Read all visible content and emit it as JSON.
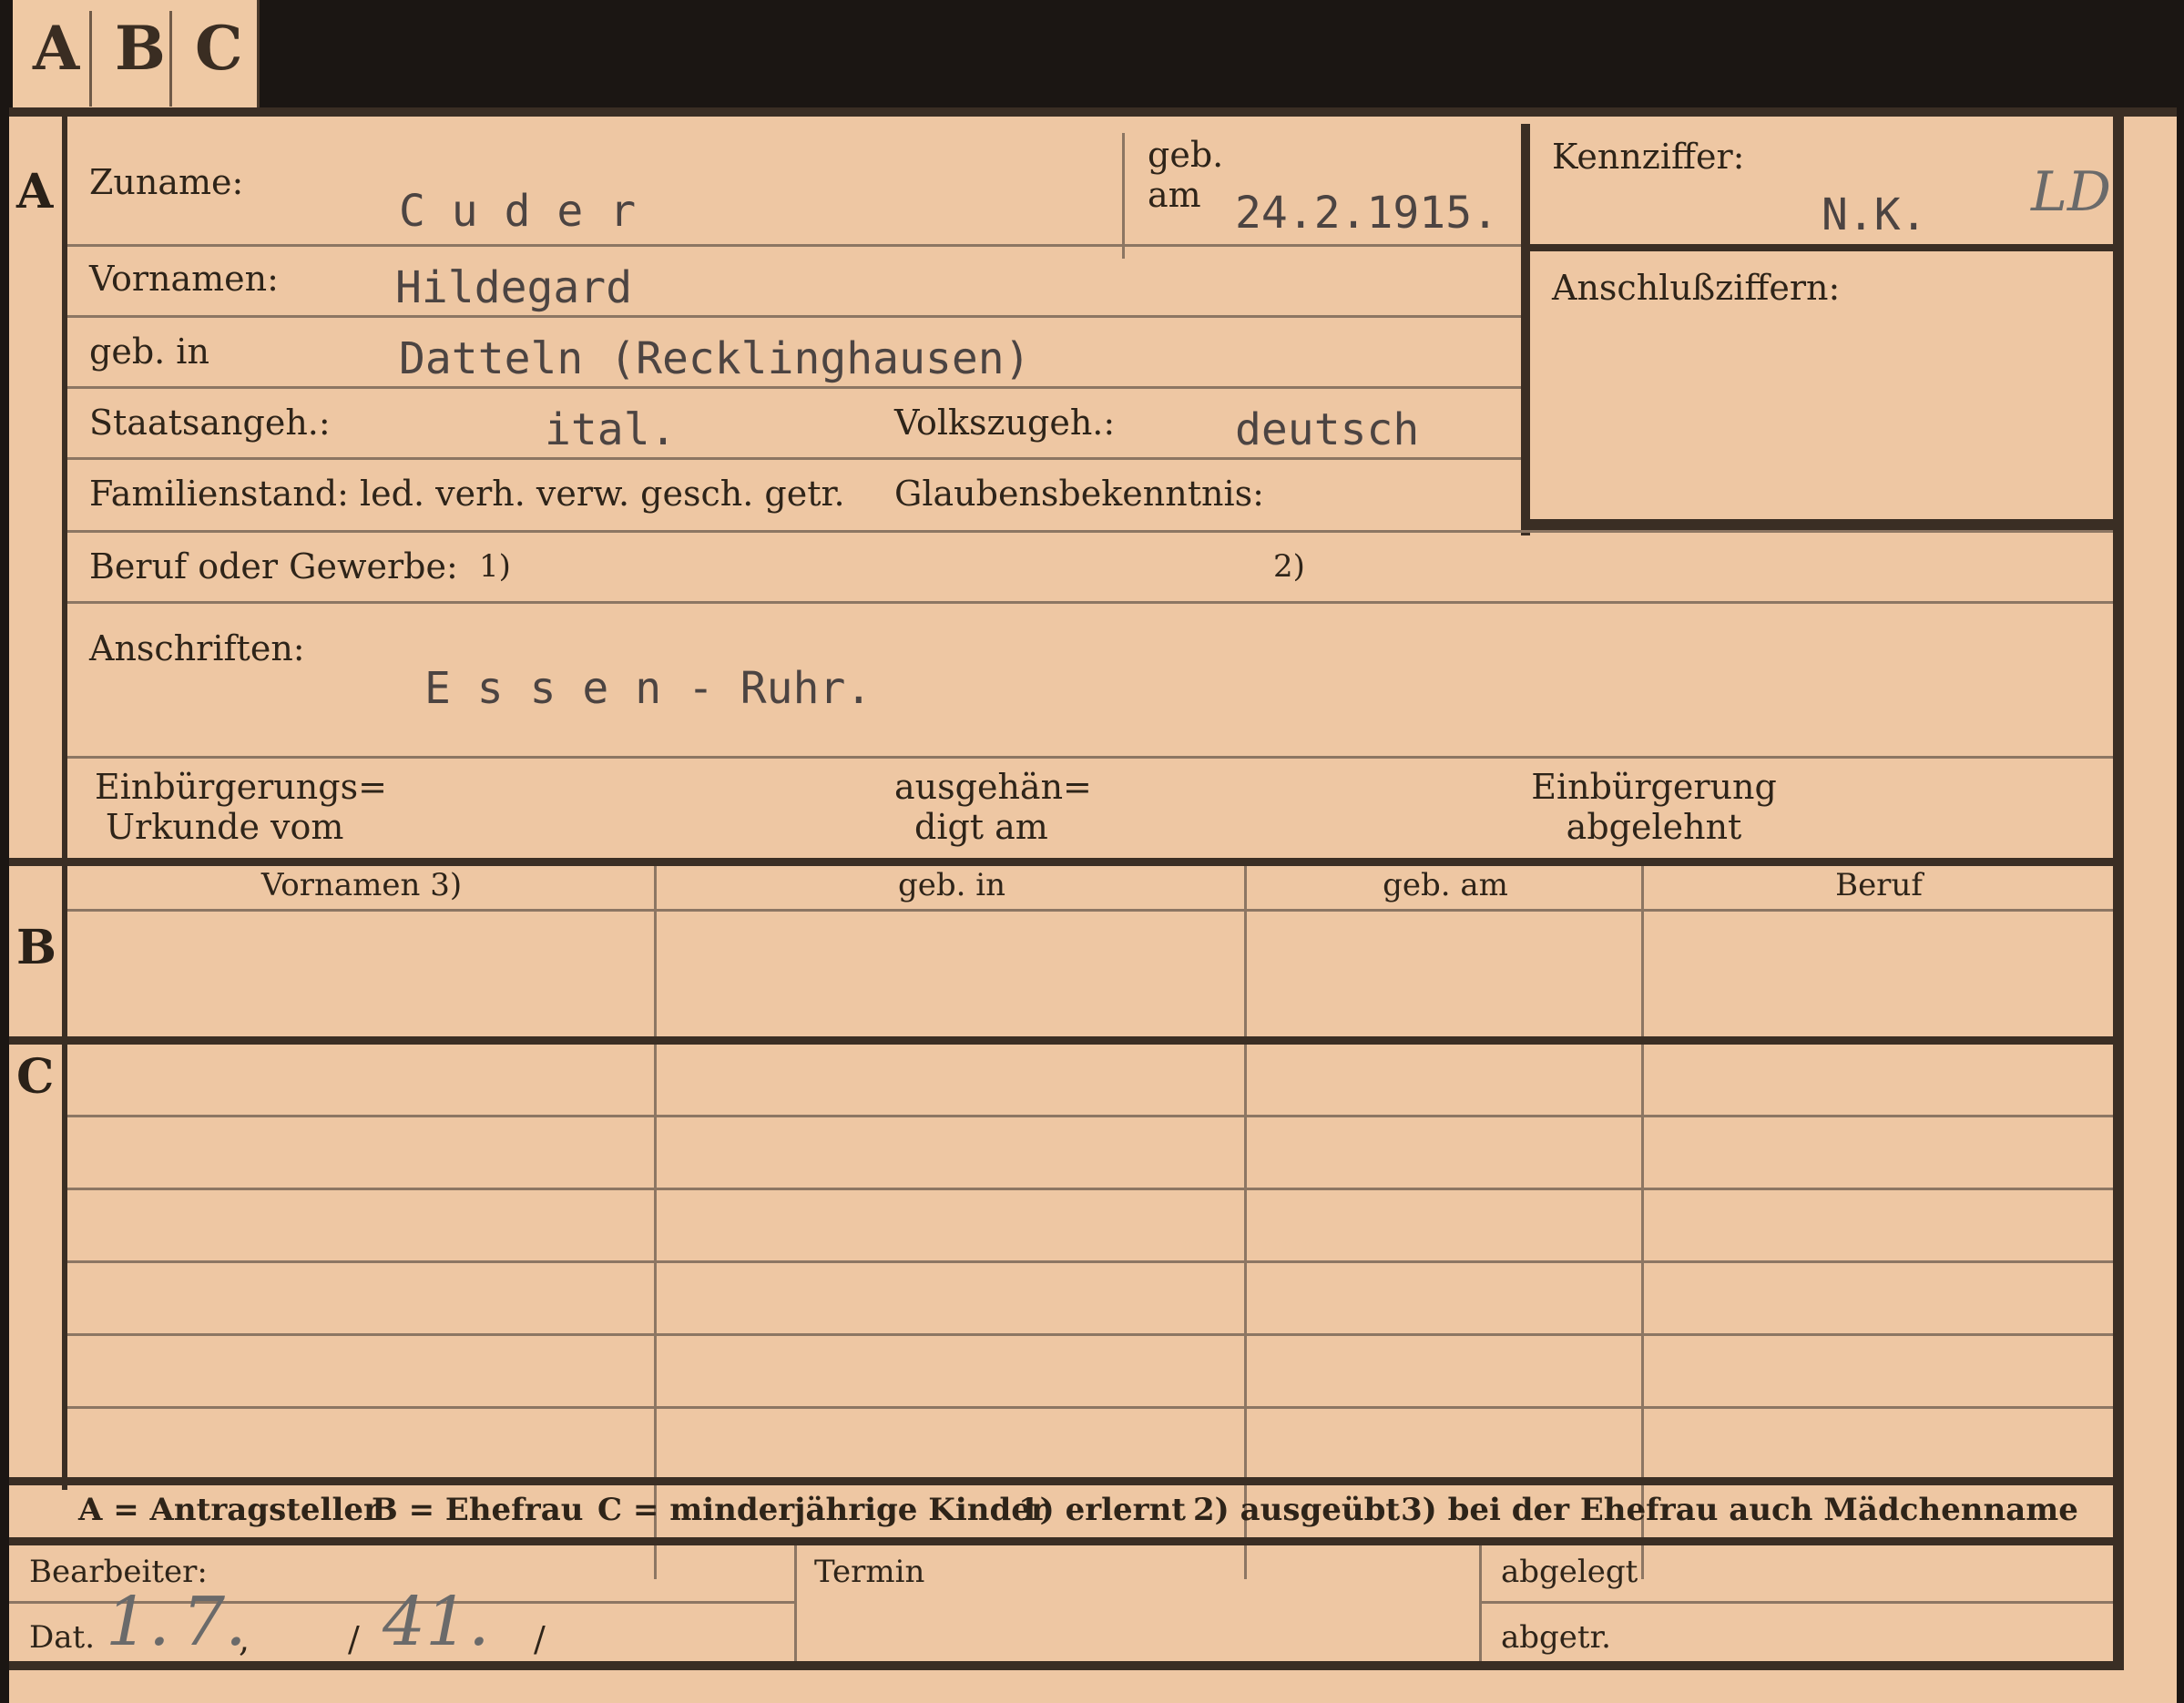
{
  "tabs": [
    "A",
    "B",
    "C"
  ],
  "section_a": {
    "marker": "A",
    "zuname_label": "Zuname:",
    "zuname_value": "C u d e r",
    "geb_am_label_1": "geb.",
    "geb_am_label_2": "am",
    "geb_am_value": "24.2.1915.",
    "vornamen_label": "Vornamen:",
    "vornamen_value": "Hildegard",
    "geb_in_label": "geb. in",
    "geb_in_value": "Datteln (Recklinghausen)",
    "staatsangeh_label": "Staatsangeh.:",
    "staatsangeh_value": "ital.",
    "volkszugeh_label": "Volkszugeh.:",
    "volkszugeh_value": "deutsch",
    "familienstand_label": "Familienstand: led. verh. verw. gesch. getr.",
    "glaubensbekenntnis_label": "Glaubensbekenntnis:",
    "kennziffer_label": "Kennziffer:",
    "kennziffer_value": "N.K.",
    "kennziffer_hand": "LD",
    "anschlussziffern_label": "Anschlußziffern:",
    "beruf_label": "Beruf oder Gewerbe:",
    "beruf_note_1": "1)",
    "beruf_note_2": "2)",
    "anschriften_label": "Anschriften:",
    "anschriften_value": "E s s e n - Ruhr.",
    "einbuergerungs_line1": "Einbürgerungs=",
    "einbuergerungs_line2": "Urkunde vom",
    "ausgehaen_line1": "ausgehän=",
    "ausgehaen_line2": "digt am",
    "abgelehnt_line1": "Einbürgerung",
    "abgelehnt_line2": "abgelehnt"
  },
  "section_b": {
    "marker": "B",
    "columns": [
      "Vornamen 3)",
      "geb. in",
      "geb. am",
      "Beruf"
    ]
  },
  "section_c": {
    "marker": "C"
  },
  "legend": {
    "a": "A = Antragsteller",
    "b": "B = Ehefrau",
    "c": "C = minderjährige Kinder",
    "n1": "1) erlernt",
    "n2": "2) ausgeübt",
    "n3": "3) bei der Ehefrau auch Mädchenname"
  },
  "footer": {
    "bearbeiter_label": "Bearbeiter:",
    "dat_label": "Dat.",
    "dat_day": "1.",
    "dat_month": "7.",
    "dat_sep1": ",",
    "dat_sep2": "/",
    "dat_year": "41.",
    "dat_sep3": "/",
    "termin_label": "Termin",
    "abgelegt_label": "abgelegt",
    "abgetr_label": "abgetr."
  }
}
